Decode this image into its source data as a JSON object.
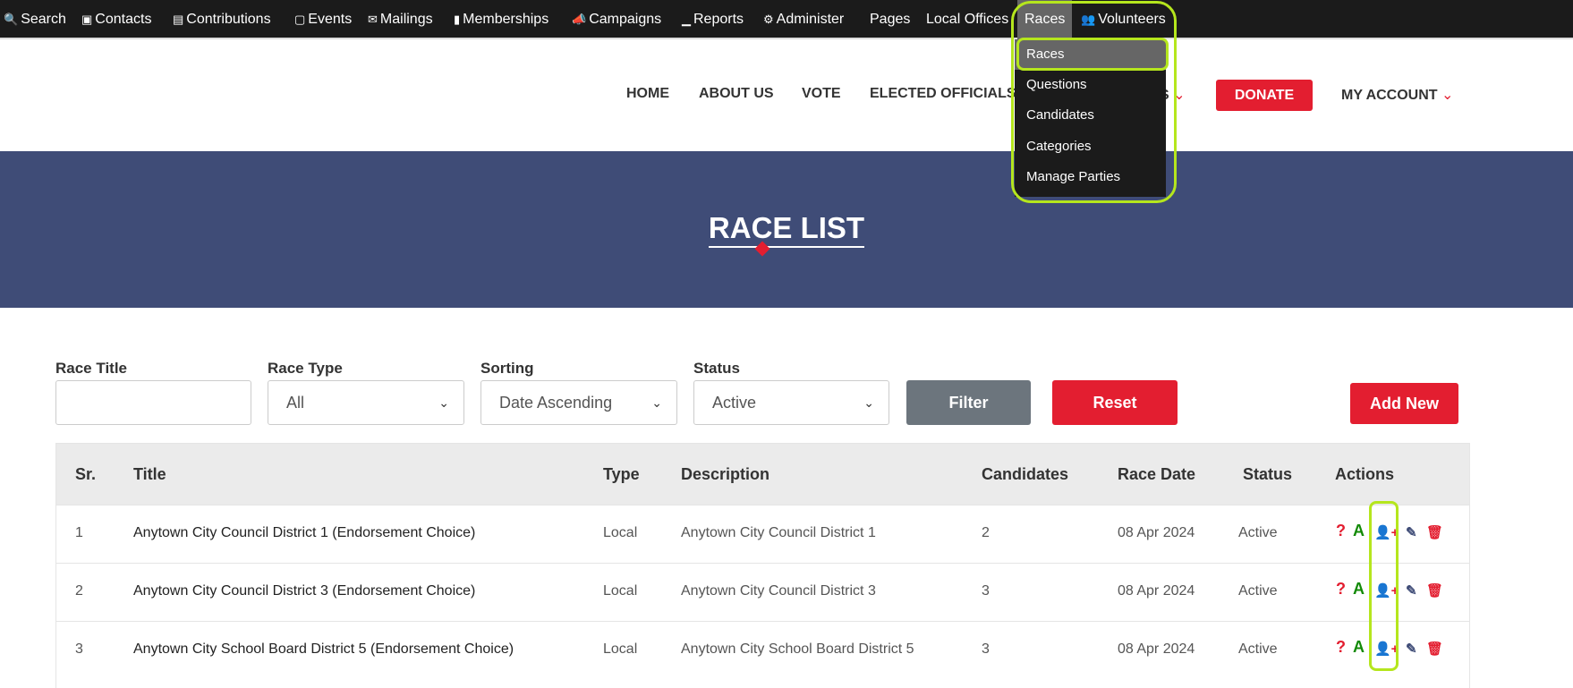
{
  "topbar": {
    "items": [
      {
        "label": "Search",
        "icon": "search-icon"
      },
      {
        "label": "Contacts",
        "icon": "contact-card-icon"
      },
      {
        "label": "Contributions",
        "icon": "credit-card-icon"
      },
      {
        "label": "Events",
        "icon": "calendar-icon"
      },
      {
        "label": "Mailings",
        "icon": "envelope-icon"
      },
      {
        "label": "Memberships",
        "icon": "id-badge-icon"
      },
      {
        "label": "Campaigns",
        "icon": "bullhorn-icon"
      },
      {
        "label": "Reports",
        "icon": "bar-chart-icon"
      },
      {
        "label": "Administer",
        "icon": "gears-icon"
      },
      {
        "label": "Pages"
      },
      {
        "label": "Local Offices"
      },
      {
        "label": "Races"
      },
      {
        "label": "Volunteers",
        "icon": "users-icon"
      }
    ]
  },
  "dropdown": {
    "items": [
      "Races",
      "Questions",
      "Candidates",
      "Categories",
      "Manage Parties"
    ]
  },
  "nav": {
    "home": "HOME",
    "about": "ABOUT US",
    "vote": "VOTE",
    "elected": "ELECTED OFFICIALS",
    "hidden": "S",
    "donate": "DONATE",
    "account": "MY ACCOUNT"
  },
  "banner": {
    "title": "RACE LIST"
  },
  "filters": {
    "race_title_label": "Race Title",
    "race_title_value": "",
    "race_type_label": "Race Type",
    "race_type_value": "All",
    "sorting_label": "Sorting",
    "sorting_value": "Date Ascending",
    "status_label": "Status",
    "status_value": "Active",
    "filter": "Filter",
    "reset": "Reset",
    "add_new": "Add New"
  },
  "table": {
    "headers": [
      "Sr.",
      "Title",
      "Type",
      "Description",
      "Candidates",
      "Race Date",
      "Status",
      "Actions"
    ],
    "rows": [
      [
        "1",
        "Anytown City Council District 1 (Endorsement Choice)",
        "Local",
        "Anytown City Council District 1",
        "2",
        "08 Apr 2024",
        "Active"
      ],
      [
        "2",
        "Anytown City Council District 3 (Endorsement Choice)",
        "Local",
        "Anytown City Council District 3",
        "3",
        "08 Apr 2024",
        "Active"
      ],
      [
        "3",
        "Anytown City School Board District 5 (Endorsement Choice)",
        "Local",
        "Anytown City School Board District 5",
        "3",
        "08 Apr 2024",
        "Active"
      ]
    ],
    "action_icons": [
      "question-icon",
      "answer-a-icon",
      "user-plus-icon",
      "edit-icon",
      "trash-icon"
    ]
  },
  "colors": {
    "accent": "#e31e30",
    "banner": "#3f4c77",
    "topbar": "#1b1b1b",
    "highlight": "#b5e61d"
  }
}
